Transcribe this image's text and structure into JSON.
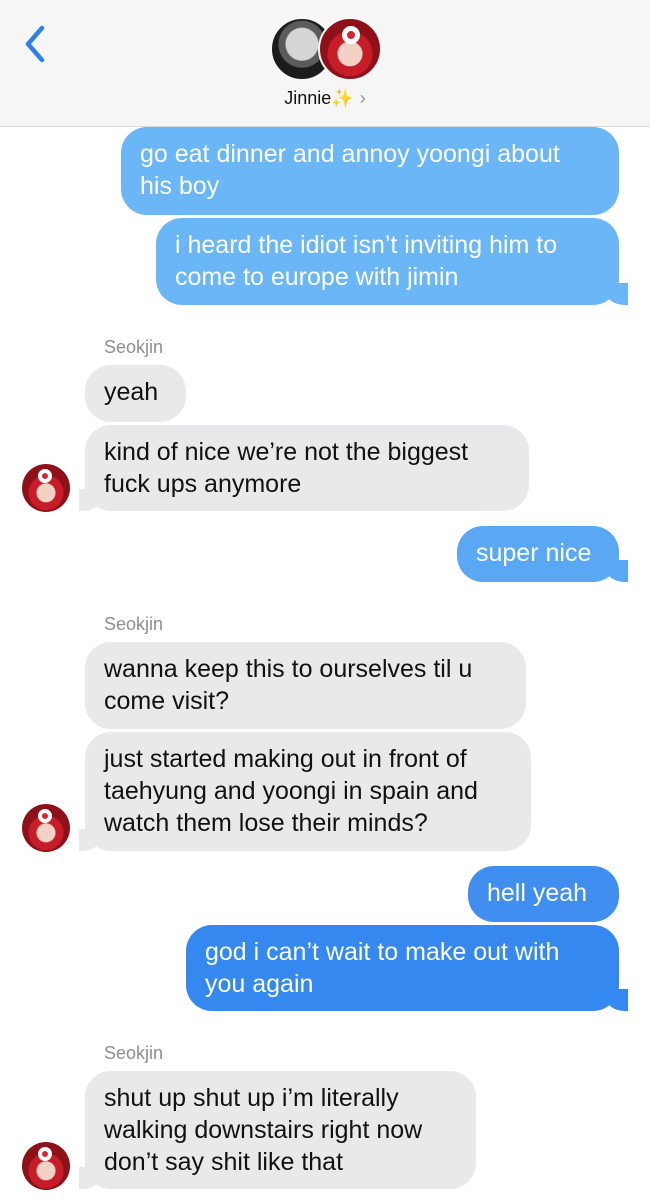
{
  "header": {
    "contact_name": "Jinnie",
    "sparkle_icon": "✨",
    "chevron": "›",
    "accent": "#2f80ed"
  },
  "sender_name": "Seokjin",
  "messages": [
    {
      "dir": "sent",
      "text": "go eat dinner and annoy yoongi about\nhis boy"
    },
    {
      "dir": "sent",
      "text": "i heard the idiot isn’t inviting him to\ncome to europe with jimin"
    },
    {
      "dir": "recv",
      "text": "yeah"
    },
    {
      "dir": "recv",
      "text": "kind of nice we’re not the biggest\nfuck ups anymore"
    },
    {
      "dir": "sent",
      "text": "super nice"
    },
    {
      "dir": "recv",
      "text": "wanna keep this to ourselves til u\ncome visit?"
    },
    {
      "dir": "recv",
      "text": "just started making out in front of\ntaehyung and yoongi in spain and\nwatch them lose their minds?"
    },
    {
      "dir": "sent",
      "text": "hell yeah"
    },
    {
      "dir": "sent",
      "text": "god i can’t wait to make out with\nyou again"
    },
    {
      "dir": "recv",
      "text": "shut up shut up i’m literally\nwalking downstairs right now\ndon’t say shit like that"
    }
  ],
  "colors": {
    "sent_light": "#6bb6f6",
    "sent_dark": "#2f80ed",
    "received": "#e9e9eb"
  }
}
